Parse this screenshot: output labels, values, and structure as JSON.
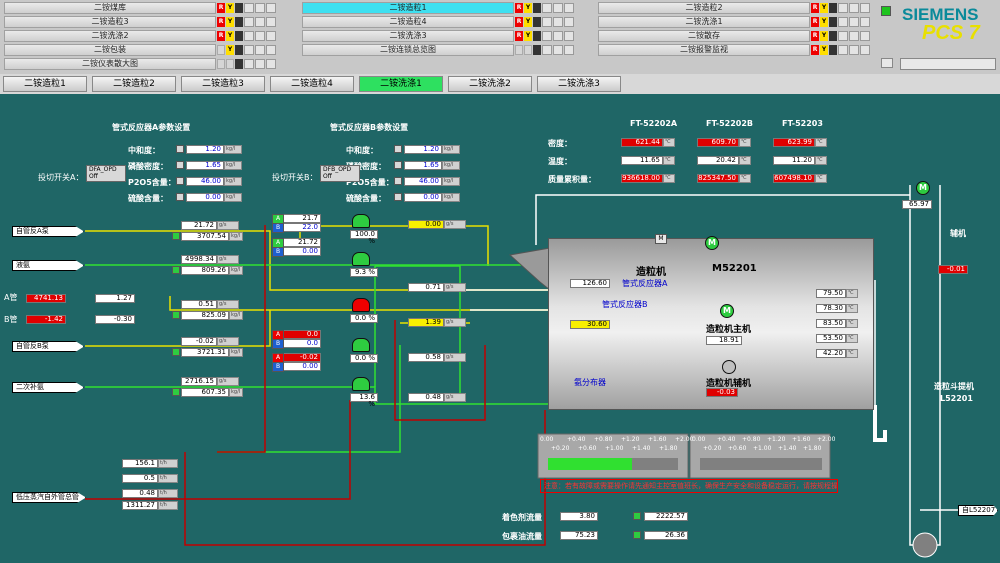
{
  "nav": {
    "col1": [
      "二铵煤库",
      "二铵造粒3",
      "二铵洗涤2",
      "二铵包装",
      "二铵仪表散大图"
    ],
    "col2": [
      "二铵造粒1",
      "二铵造粒4",
      "二铵洗涤3",
      "二铵连锁总览图"
    ],
    "col3": [
      "二铵造粒2",
      "二铵洗涤1",
      "二铵散存",
      "二铵报警监视"
    ],
    "ind_r": "R",
    "ind_y": "Y",
    "ind_d": "D"
  },
  "brand": {
    "name": "SIEMENS",
    "product": "PCS 7"
  },
  "tabs": [
    "二铵造粒1",
    "二铵造粒2",
    "二铵造粒3",
    "二铵造粒4",
    "二铵洗涤1",
    "二铵洗涤2",
    "二铵洗涤3"
  ],
  "active_tab": 4,
  "paramA": {
    "title": "管式反应器A参数设置",
    "labels": [
      "中和度：",
      "磷酸密度：",
      "P2O5含量：",
      "硫酸含量："
    ],
    "values": [
      "1.20",
      "1.65",
      "46.00",
      "0.00"
    ],
    "switch_label": "投切开关A：",
    "switch_tag": "DFA_OPD",
    "switch_state": "Off"
  },
  "paramB": {
    "title": "管式反应器B参数设置",
    "labels": [
      "中和度：",
      "磷酸密度：",
      "P2O5含量：",
      "硫酸含量："
    ],
    "values": [
      "1.20",
      "1.65",
      "46.00",
      "0.00"
    ],
    "switch_label": "投切开关B：",
    "switch_tag": "DFB_OPD",
    "switch_state": "Off"
  },
  "ft": {
    "headers": [
      "FT-52202A",
      "FT-52202B",
      "FT-52203"
    ],
    "rows": [
      {
        "label": "密度：",
        "values": [
          "621.44",
          "609.70",
          "623.99"
        ]
      },
      {
        "label": "温度：",
        "values": [
          "11.65",
          "20.42",
          "11.20"
        ]
      },
      {
        "label": "质量累积量：",
        "values": [
          "936618.00",
          "825347.50",
          "607498.10"
        ]
      }
    ]
  },
  "inlets": [
    "自管反A泵",
    "液氨",
    "自管反B泵",
    "二次补氨",
    "低压蒸汽自外管总管"
  ],
  "pipeA": {
    "label": "A管",
    "left": "4741.13",
    "right": "1.27"
  },
  "pipeB": {
    "label": "B管",
    "left": "-1.42",
    "right": "-0.30"
  },
  "flows": [
    {
      "top": "21.72",
      "bottom": "3707.54"
    },
    {
      "top": "4998.34",
      "bottom": "809.26"
    },
    {
      "top": "0.51",
      "bottom": "825.09"
    },
    {
      "top": "-0.02",
      "bottom": "3721.31"
    },
    {
      "top": "2716.15",
      "bottom": "607.35"
    }
  ],
  "controllers": [
    {
      "top": "21.7",
      "bottom": "22.0",
      "open": "100.0 %"
    },
    {
      "top": "21.72",
      "bottom": "0.00",
      "open": "9.3 %"
    },
    {
      "top": "0.0",
      "bottom": "0.0",
      "open": "0.0 %"
    },
    {
      "top": "-0.02",
      "bottom": "0.00",
      "open": "0.0 %"
    },
    {
      "top": "",
      "bottom": "",
      "open": "13.6 %"
    }
  ],
  "lineValues": [
    "0.00",
    "0.71",
    "1.39",
    "0.58",
    "0.48"
  ],
  "granulator": {
    "title": "造粒机",
    "tag": "M52201",
    "value1": "126.60",
    "reactorA": "管式反应器A",
    "reactorB": "管式反应器B",
    "value2": "30.60",
    "distributor": "氨分布器",
    "main_label": "造粒机主机",
    "main_value": "18.91",
    "aux_label": "造粒机辅机",
    "aux_value": "-0.03",
    "side_values": [
      "79.50",
      "78.30",
      "83.50",
      "53.50",
      "42.20"
    ]
  },
  "elevator": {
    "label": "造粒斗提机",
    "tag": "L52201",
    "value": "65.97",
    "aux_label": "辅机",
    "aux_value": "-0.01",
    "exit_label": "自L52207"
  },
  "scales": {
    "left": [
      "0.00",
      "+0.40",
      "+0.80",
      "+1.20",
      "+1.60",
      "+2.00"
    ],
    "left2": [
      "+0.20",
      "+0.60",
      "+1.00",
      "+1.40",
      "+1.80"
    ],
    "right": [
      "0.00",
      "+0.40",
      "+0.80",
      "+1.20",
      "+1.60",
      "+2.00"
    ],
    "right2": [
      "+0.20",
      "+0.60",
      "+1.00",
      "+1.40",
      "+1.80"
    ]
  },
  "alarm_text": "注意：若有故障或需要操作请先通知主控室值班长，确保生产安全和设备稳定运行，请按规程操作！",
  "steam": [
    "156.1",
    "0.5",
    "0.48",
    "1311.27"
  ],
  "bottom": {
    "coloring_label": "着色剂流量",
    "coloring_value": "3.80",
    "coloring_total": "2222.57",
    "coating_label": "包裹油流量",
    "coating_value": "75.23",
    "coating_total": "26.36"
  },
  "marks": {
    "m": "M",
    "a": "A",
    "b": "B",
    "l": "L"
  },
  "units": {
    "gs": "g/s",
    "kgh": "kg/h",
    "pct": "%",
    "c": "℃",
    "kg": "kg/l",
    "th": "t/h"
  },
  "colors": {
    "bg": "#1f6666",
    "pipe_yellow": "#e8e000",
    "pipe_green": "#30e030",
    "pipe_red": "#c00000",
    "pipe_white": "#ffffff"
  }
}
